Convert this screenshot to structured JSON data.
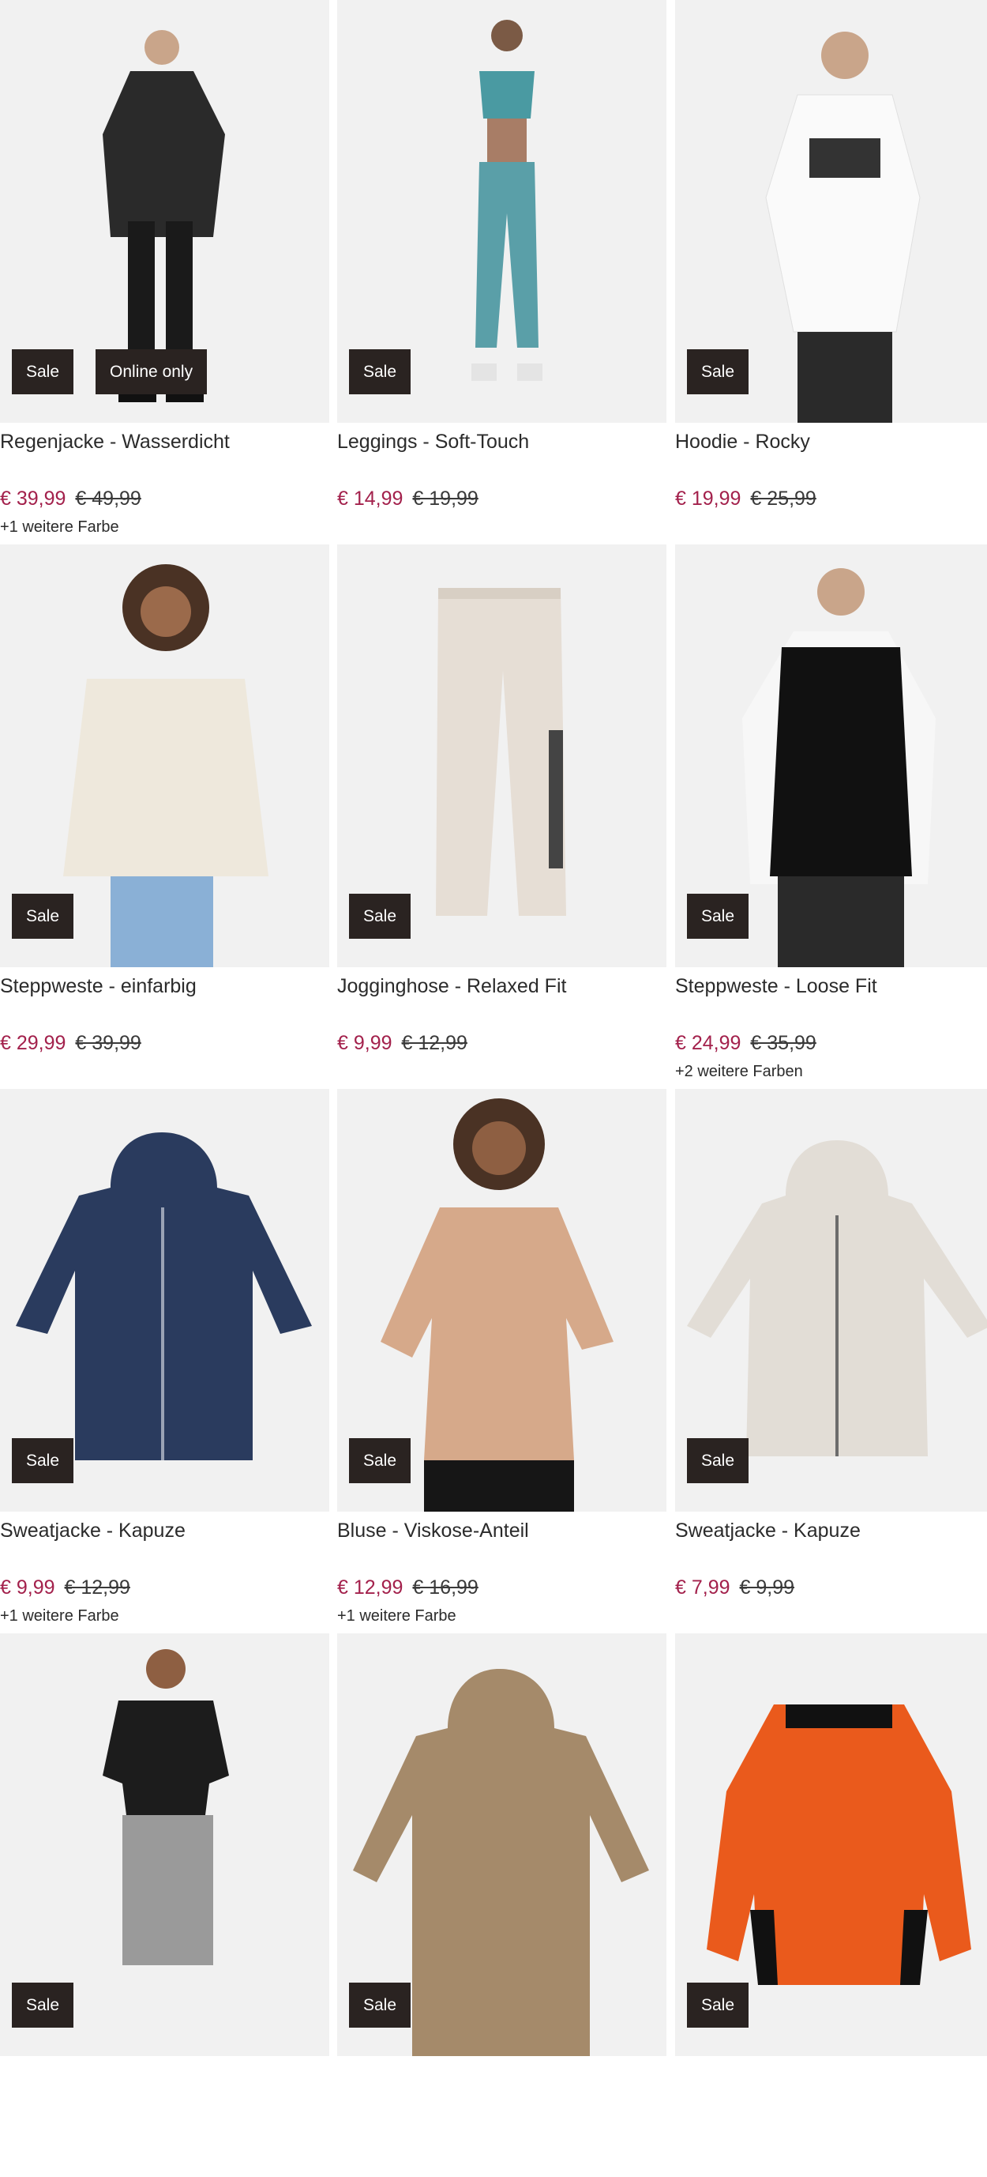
{
  "products": [
    {
      "title": "Regenjacke - Wasserdicht",
      "price": "€ 39,99",
      "old_price": "€ 49,99",
      "more": "+1 weitere Farbe",
      "badges": [
        "Sale",
        "Online only"
      ],
      "image": "rain-jacket-man"
    },
    {
      "title": "Leggings - Soft-Touch",
      "price": "€ 14,99",
      "old_price": "€ 19,99",
      "more": "",
      "badges": [
        "Sale"
      ],
      "image": "leggings-woman"
    },
    {
      "title": "Hoodie - Rocky",
      "price": "€ 19,99",
      "old_price": "€ 25,99",
      "more": "",
      "badges": [
        "Sale"
      ],
      "image": "white-hoodie-man"
    },
    {
      "title": "Steppweste - einfarbig",
      "price": "€ 29,99",
      "old_price": "€ 39,99",
      "more": "",
      "badges": [
        "Sale"
      ],
      "image": "cream-vest-woman"
    },
    {
      "title": "Jogginghose - Relaxed Fit",
      "price": "€ 9,99",
      "old_price": "€ 12,99",
      "more": "",
      "badges": [
        "Sale"
      ],
      "image": "jogging-pants"
    },
    {
      "title": "Steppweste - Loose Fit",
      "price": "€ 24,99",
      "old_price": "€ 35,99",
      "more": "+2 weitere Farben",
      "badges": [
        "Sale"
      ],
      "image": "black-vest-man"
    },
    {
      "title": "Sweatjacke - Kapuze",
      "price": "€ 9,99",
      "old_price": "€ 12,99",
      "more": "+1 weitere Farbe",
      "badges": [
        "Sale"
      ],
      "image": "navy-hoodie-jacket"
    },
    {
      "title": "Bluse - Viskose-Anteil",
      "price": "€ 12,99",
      "old_price": "€ 16,99",
      "more": "+1 weitere Farbe",
      "badges": [
        "Sale"
      ],
      "image": "beige-blouse-woman"
    },
    {
      "title": "Sweatjacke - Kapuze",
      "price": "€ 7,99",
      "old_price": "€ 9,99",
      "more": "",
      "badges": [
        "Sale"
      ],
      "image": "grey-hoodie-jacket"
    },
    {
      "title": "",
      "price": "",
      "old_price": "",
      "more": "",
      "badges": [
        "Sale"
      ],
      "image": "nasa-tshirt-man"
    },
    {
      "title": "",
      "price": "",
      "old_price": "",
      "more": "",
      "badges": [
        "Sale"
      ],
      "image": "knit-cardigan"
    },
    {
      "title": "",
      "price": "",
      "old_price": "",
      "more": "",
      "badges": [
        "Sale"
      ],
      "image": "orange-hoodie"
    }
  ],
  "colors": {
    "sale_price": "#a3214c",
    "badge_bg": "#2a2321",
    "image_bg": "#f1f1f1"
  }
}
